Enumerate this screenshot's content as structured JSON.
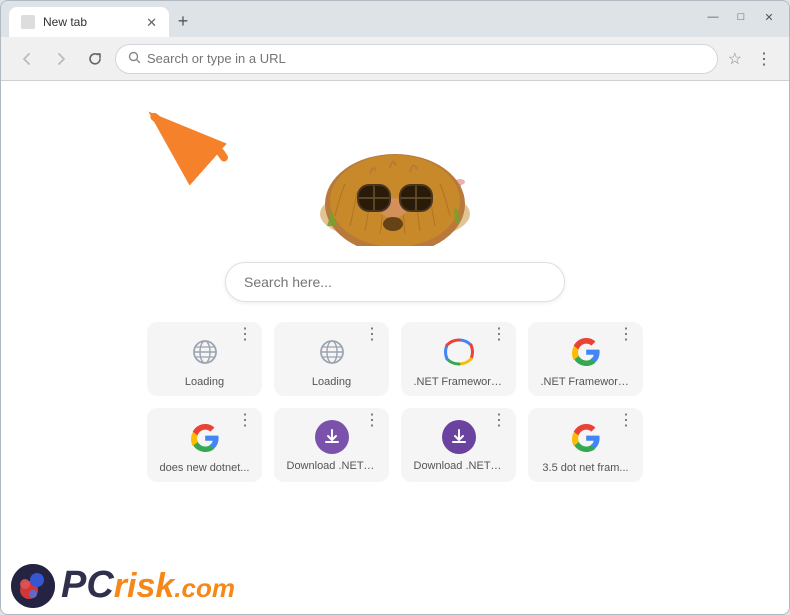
{
  "browser": {
    "tab_label": "New tab",
    "new_tab_symbol": "+",
    "window_controls": {
      "minimize": "—",
      "maximize": "□",
      "close": "✕"
    },
    "address_bar": {
      "placeholder": "Search or type in a URL",
      "value": ""
    }
  },
  "content": {
    "search_placeholder": "Search here...",
    "arrow_symbol": "➤"
  },
  "speed_dial": {
    "items": [
      {
        "id": 1,
        "label": "Loading",
        "icon_type": "globe",
        "menu": "⋮"
      },
      {
        "id": 2,
        "label": "Loading",
        "icon_type": "globe",
        "menu": "⋮"
      },
      {
        "id": 3,
        "label": ".NET Framework ...",
        "icon_type": "dotnet",
        "menu": "⋮"
      },
      {
        "id": 4,
        "label": ".NET Framework ...",
        "icon_type": "google",
        "menu": "⋮"
      },
      {
        "id": 5,
        "label": "does new dotnet...",
        "icon_type": "google",
        "menu": "⋮"
      },
      {
        "id": 6,
        "label": "Download .NET F...",
        "icon_type": "purple",
        "menu": "⋮"
      },
      {
        "id": 7,
        "label": "Download .NET F...",
        "icon_type": "purple2",
        "menu": "⋮"
      },
      {
        "id": 8,
        "label": "3.5 dot net fram...",
        "icon_type": "google",
        "menu": "⋮"
      }
    ]
  },
  "watermark": {
    "pc_text": "PC",
    "risk_text": "risk",
    "com_text": ".com"
  }
}
